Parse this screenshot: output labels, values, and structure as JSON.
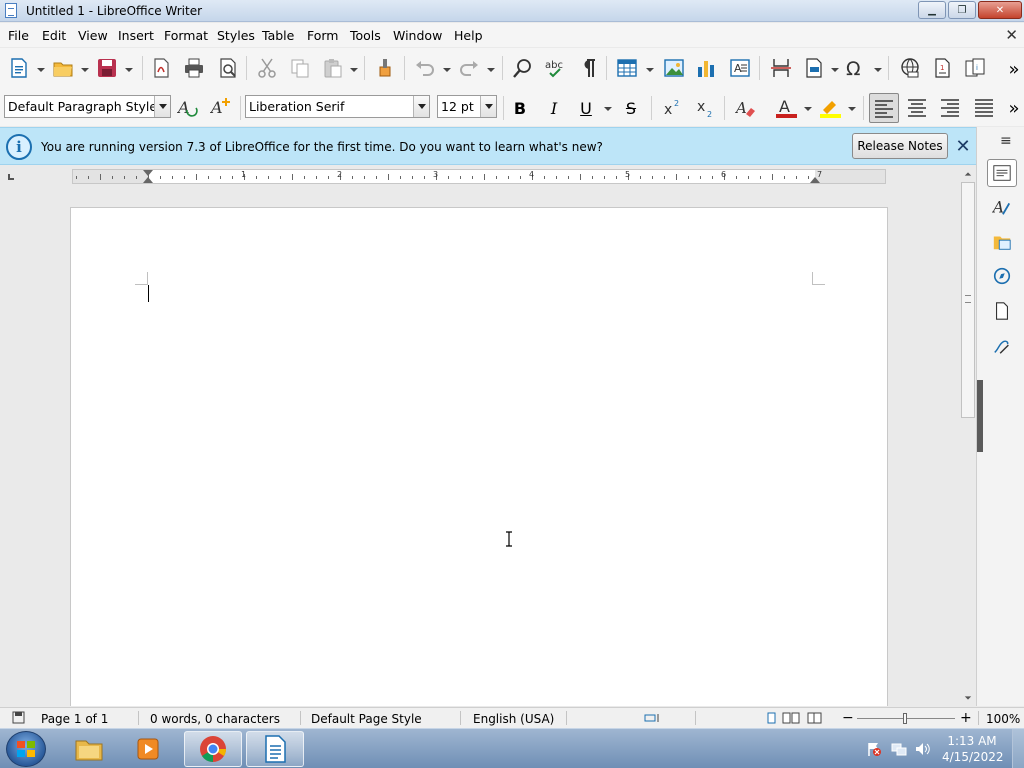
{
  "window": {
    "title": "Untitled 1 - LibreOffice Writer",
    "controls": {
      "minimize": "▁",
      "maximize": "❐",
      "close": "✕"
    }
  },
  "menubar": {
    "items": [
      "File",
      "Edit",
      "View",
      "Insert",
      "Format",
      "Styles",
      "Table",
      "Form",
      "Tools",
      "Window",
      "Help"
    ],
    "close_glyph": "✕"
  },
  "formatting": {
    "paragraph_style": "Default Paragraph Style",
    "font_name": "Liberation Serif",
    "font_size": "12 pt",
    "bold": "B",
    "italic": "I",
    "underline": "U",
    "strikethrough": "S",
    "more": "»"
  },
  "standard_toolbar": {
    "more": "»"
  },
  "infobar": {
    "message": "You are running version 7.3 of LibreOffice for the first time. Do you want to learn what's new?",
    "button": "Release Notes",
    "close": "✕"
  },
  "ruler": {
    "numbers": [
      "1",
      "2",
      "3",
      "4",
      "5",
      "6",
      "7"
    ]
  },
  "sidebar": {
    "menu": "≡"
  },
  "statusbar": {
    "page": "Page 1 of 1",
    "words": "0 words, 0 characters",
    "page_style": "Default Page Style",
    "language": "English (USA)",
    "zoom_minus": "−",
    "zoom_plus": "+",
    "zoom": "100%"
  },
  "taskbar": {
    "time": "1:13 AM",
    "date": "4/15/2022"
  },
  "colors": {
    "infobar_bg": "#bde5f8",
    "font_color": "#c9211e",
    "highlight": "#ffff00",
    "titlebar": "#c5d6ea"
  }
}
